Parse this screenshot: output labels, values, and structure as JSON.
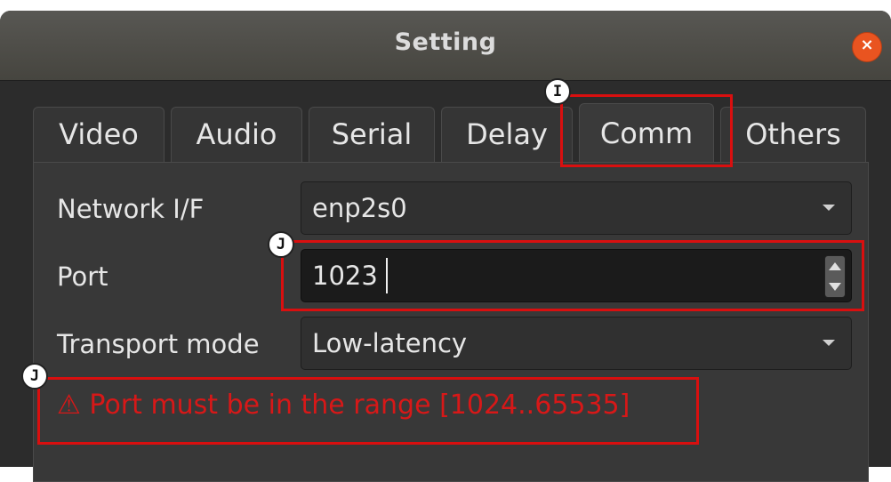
{
  "window": {
    "title": "Setting",
    "close_glyph": "×"
  },
  "tabs": [
    {
      "label": "Video"
    },
    {
      "label": "Audio"
    },
    {
      "label": "Serial"
    },
    {
      "label": "Delay"
    },
    {
      "label": "Comm",
      "active": true
    },
    {
      "label": "Others"
    }
  ],
  "form": {
    "network_if": {
      "label": "Network I/F",
      "value": "enp2s0"
    },
    "port": {
      "label": "Port",
      "value": "1023"
    },
    "transport": {
      "label": "Transport mode",
      "value": "Low-latency"
    }
  },
  "error": {
    "icon": "warning-icon",
    "text": "⚠ Port must be in the range [1024..65535]"
  },
  "annotations": {
    "marker_i": "I",
    "marker_j1": "J",
    "marker_j2": "J"
  },
  "colors": {
    "accent_close": "#e95420",
    "error_text": "#d71818",
    "highlight": "#d90f0f"
  }
}
